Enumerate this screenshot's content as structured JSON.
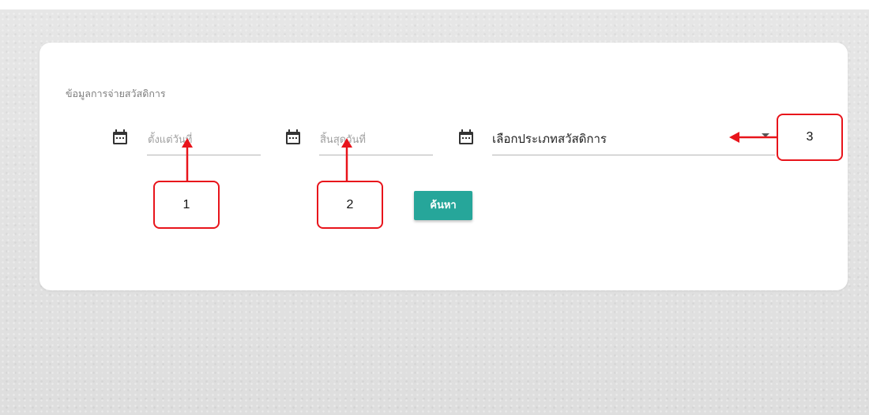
{
  "form": {
    "section_title": "ข้อมูลการจ่ายสวัสดิการ",
    "start_date_placeholder": "ตั้งแต่วันที่",
    "end_date_placeholder": "สิ้นสุดวันที่",
    "welfare_type_value": "เลือกประเภทสวัสดิการ",
    "search_label": "ค้นหา"
  },
  "annotations": [
    {
      "label": "1"
    },
    {
      "label": "2"
    },
    {
      "label": "3"
    }
  ],
  "colors": {
    "button": "#26a69a",
    "annotation": "#e8141b",
    "card": "#ffffff"
  },
  "icons": {
    "date_field": "calendar-icon",
    "select": "caret-down-icon"
  }
}
